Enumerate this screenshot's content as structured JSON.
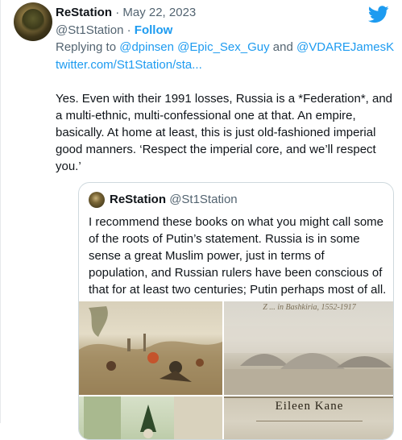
{
  "tweet": {
    "display_name": "ReStation",
    "separator": "·",
    "date": "May 22, 2023",
    "handle": "@St1Station",
    "follow_sep": "·",
    "follow_label": "Follow",
    "replying_prefix": "Replying to",
    "mentions": [
      "@dpinsen",
      "@Epic_Sex_Guy",
      "@VDAREJamesK"
    ],
    "replying_and": "and",
    "link_text": "twitter.com/St1Station/sta...",
    "body": "Yes. Even with their 1991 losses, Russia is a *Federation*, and a multi-ethnic, multi-confessional one at that. An empire, basically. At home at least, this is just old-fashioned imperial good manners. ‘Respect the imperial core, and we’ll respect you.’"
  },
  "quoted": {
    "display_name": "ReStation",
    "handle": "@St1Station",
    "body": "I recommend these books on what you might call some of the roots of Putin’s statement. Russia is in some sense a great Muslim power, just in terms of population, and Russian rulers have been conscious of that for at least two centuries; Putin perhaps most of all.",
    "cover_subtitle": "Z ... in Bashkiria, 1552-1917",
    "cover_author": "Eileen Kane"
  },
  "icons": {
    "platform": "twitter-bird-icon"
  },
  "colors": {
    "accent": "#1d9bf0",
    "secondary_text": "#536471",
    "text": "#0f1419",
    "border": "#cfd9de"
  }
}
